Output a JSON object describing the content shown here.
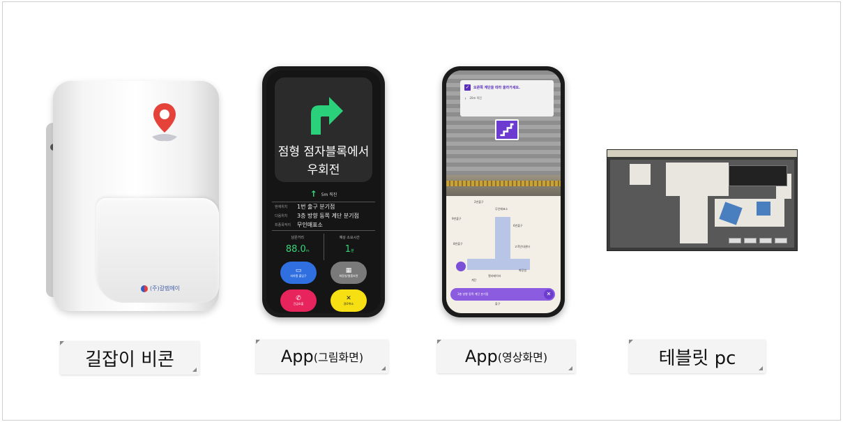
{
  "labels": {
    "beacon": "길잡이 비콘",
    "app_drawing_prefix": "App",
    "app_drawing_suffix": "(그림화면)",
    "app_video_prefix": "App",
    "app_video_suffix": "(영상화면)",
    "tablet": "테블릿 pc"
  },
  "phone1": {
    "title_line1": "점형 점자블록에서",
    "title_line2": "우회전",
    "step": "5m 직진",
    "info": [
      {
        "key": "현재위치",
        "value": "1번 출구 분기점"
      },
      {
        "key": "다음위치",
        "value": "3층 방향 동쪽 계단 분기점"
      },
      {
        "key": "최종목적지",
        "value": "무인매표소"
      }
    ],
    "stats": [
      {
        "label": "남은거리",
        "value": "88.0",
        "unit": "m"
      },
      {
        "label": "예상 소요시간",
        "value": "1",
        "unit": "분"
      }
    ],
    "buttons": [
      {
        "label": "지하철 출입구",
        "icon": "camera-icon",
        "color": "#2f6fe0"
      },
      {
        "label": "화장실/물품보관",
        "icon": "locker-icon",
        "color": "#7a7a7a"
      },
      {
        "label": "긴급호출",
        "icon": "phone-icon",
        "color": "#e8245c"
      },
      {
        "label": "경로취소",
        "icon": "close-icon",
        "color": "#f6df12"
      }
    ]
  },
  "phone2": {
    "banner_text": "오른쪽 계단을 따라 올라가세요.",
    "banner_step": "20m 직진",
    "map_labels": [
      "2번출구",
      "무인매표소",
      "9번출구",
      "6번출구",
      "8번출구",
      "고객안내센터",
      "계단",
      "화장실",
      "엘리베이터",
      "출구"
    ],
    "route_text": "3층 방향 동쪽 계단 분기점"
  },
  "brand": "(주)갈렙에이"
}
